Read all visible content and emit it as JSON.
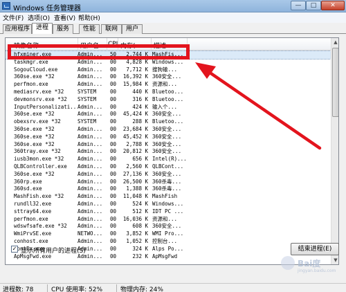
{
  "window": {
    "title": "Windows 任务管理器",
    "minimize_label": "—",
    "maximize_label": "□",
    "close_label": "✕"
  },
  "menu": [
    "文件(F)",
    "选项(O)",
    "查看(V)",
    "帮助(H)"
  ],
  "tabs": [
    "应用程序",
    "进程",
    "服务",
    "性能",
    "联网",
    "用户"
  ],
  "active_tab": "进程",
  "columns": [
    "映像名称",
    "用户名",
    "CPU",
    "内存(...",
    "描述"
  ],
  "processes": [
    {
      "name": "hfxminer.exe",
      "user": "Admin...",
      "cpu": "50",
      "mem": "2,744 K",
      "desc": "MashFis..."
    },
    {
      "name": "taskmgr.exe",
      "user": "Admin...",
      "cpu": "00",
      "mem": "4,828 K",
      "desc": "Windows..."
    },
    {
      "name": "SogouCloud.exe",
      "user": "Admin...",
      "cpu": "00",
      "mem": "7,712 K",
      "desc": "搜狗输..."
    },
    {
      "name": "360se.exe *32",
      "user": "Admin...",
      "cpu": "00",
      "mem": "16,392 K",
      "desc": "360安全..."
    },
    {
      "name": "perfmon.exe",
      "user": "Admin...",
      "cpu": "00",
      "mem": "15,984 K",
      "desc": "资源和..."
    },
    {
      "name": "mediasrv.exe *32",
      "user": "SYSTEM",
      "cpu": "00",
      "mem": "440 K",
      "desc": "Bluetoo..."
    },
    {
      "name": "devmonsrv.exe *32",
      "user": "SYSTEM",
      "cpu": "00",
      "mem": "316 K",
      "desc": "Bluetoo..."
    },
    {
      "name": "InputPersonalizati...",
      "user": "Admin...",
      "cpu": "00",
      "mem": "424 K",
      "desc": "输入个..."
    },
    {
      "name": "360se.exe *32",
      "user": "Admin...",
      "cpu": "00",
      "mem": "45,424 K",
      "desc": "360安全..."
    },
    {
      "name": "obexsrv.exe *32",
      "user": "SYSTEM",
      "cpu": "00",
      "mem": "288 K",
      "desc": "Bluetoo..."
    },
    {
      "name": "360se.exe *32",
      "user": "Admin...",
      "cpu": "00",
      "mem": "23,684 K",
      "desc": "360安全..."
    },
    {
      "name": "360se.exe *32",
      "user": "Admin...",
      "cpu": "00",
      "mem": "45,452 K",
      "desc": "360安全..."
    },
    {
      "name": "360se.exe *32",
      "user": "Admin...",
      "cpu": "00",
      "mem": "2,788 K",
      "desc": "360安全..."
    },
    {
      "name": "360tray.exe *32",
      "user": "Admin...",
      "cpu": "00",
      "mem": "20,812 K",
      "desc": "360安全..."
    },
    {
      "name": "iusb3mon.exe *32",
      "user": "Admin...",
      "cpu": "00",
      "mem": "656 K",
      "desc": "Intel(R)..."
    },
    {
      "name": "QLBController.exe",
      "user": "Admin...",
      "cpu": "00",
      "mem": "2,560 K",
      "desc": "QLBCont..."
    },
    {
      "name": "360se.exe *32",
      "user": "Admin...",
      "cpu": "00",
      "mem": "27,136 K",
      "desc": "360安全..."
    },
    {
      "name": "360rp.exe",
      "user": "Admin...",
      "cpu": "00",
      "mem": "26,500 K",
      "desc": "360杀毒..."
    },
    {
      "name": "360sd.exe",
      "user": "Admin...",
      "cpu": "00",
      "mem": "1,388 K",
      "desc": "360杀毒..."
    },
    {
      "name": "MashFish.exe *32",
      "user": "Admin...",
      "cpu": "00",
      "mem": "11,048 K",
      "desc": "MashFish"
    },
    {
      "name": "rundll32.exe",
      "user": "Admin...",
      "cpu": "00",
      "mem": "524 K",
      "desc": "Windows..."
    },
    {
      "name": "sttray64.exe",
      "user": "Admin...",
      "cpu": "00",
      "mem": "512 K",
      "desc": "IDT PC ..."
    },
    {
      "name": "perfmon.exe",
      "user": "Admin...",
      "cpu": "00",
      "mem": "16,036 K",
      "desc": "资源和..."
    },
    {
      "name": "wdswfsafe.exe *32",
      "user": "Admin...",
      "cpu": "00",
      "mem": "608 K",
      "desc": "360安全..."
    },
    {
      "name": "WmiPrvSE.exe",
      "user": "NETWO...",
      "cpu": "00",
      "mem": "3,852 K",
      "desc": "WMI Pro..."
    },
    {
      "name": "conhost.exe",
      "user": "Admin...",
      "cpu": "00",
      "mem": "1,052 K",
      "desc": "控制台..."
    },
    {
      "name": "ApntEx.exe",
      "user": "Admin...",
      "cpu": "00",
      "mem": "324 K",
      "desc": "Alps Po..."
    },
    {
      "name": "ApMsgFwd.exe",
      "user": "Admin...",
      "cpu": "00",
      "mem": "232 K",
      "desc": "ApMsgFwd"
    }
  ],
  "selected_index": 0,
  "show_all_users_label": "显示所有用户的进程(S)",
  "show_all_users_checked": "✓",
  "end_process_label": "结束进程(E)",
  "status": {
    "processes": "进程数: 78",
    "cpu": "CPU 使用率: 52%",
    "memory": "物理内存: 24%"
  },
  "annotation_color": "#e3141d",
  "watermark": {
    "text": "Bai度",
    "sub": "jingyan.baidu.com"
  }
}
